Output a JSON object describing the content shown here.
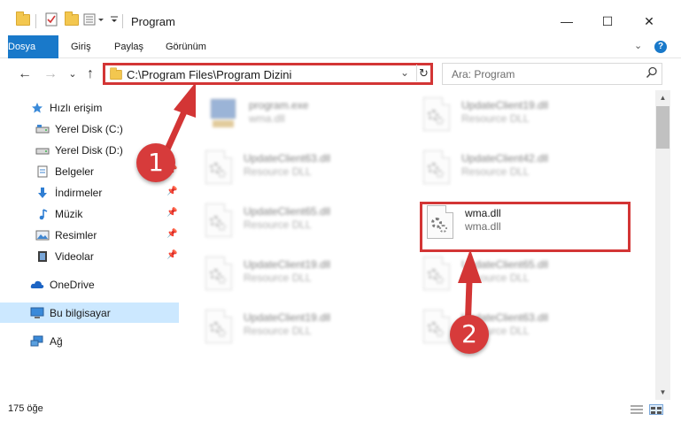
{
  "window": {
    "title": "Program",
    "minimize_glyph": "—",
    "maximize_glyph": "☐",
    "close_glyph": "✕"
  },
  "ribbon": {
    "tabs": [
      "Dosya",
      "Giriş",
      "Paylaş",
      "Görünüm"
    ],
    "help_label": "?",
    "collapse_glyph": "⌄"
  },
  "address": {
    "back_glyph": "←",
    "forward_glyph": "→",
    "recent_glyph": "⌄",
    "up_glyph": "↑",
    "path": "C:\\Program Files\\Program Dizini",
    "dropdown_glyph": "⌄",
    "refresh_glyph": "↻"
  },
  "search": {
    "placeholder": "Ara: Program"
  },
  "navigation": {
    "items": [
      {
        "label": "Hızlı erişim",
        "icon": "star-icon"
      },
      {
        "label": "Yerel Disk (C:)",
        "icon": "drive-icon",
        "pinned": true
      },
      {
        "label": "Yerel Disk (D:)",
        "icon": "drive-icon",
        "pinned": true
      },
      {
        "label": "Belgeler",
        "icon": "documents-icon",
        "pinned": true
      },
      {
        "label": "İndirmeler",
        "icon": "download-icon",
        "pinned": true
      },
      {
        "label": "Müzik",
        "icon": "music-icon",
        "pinned": true
      },
      {
        "label": "Resimler",
        "icon": "pictures-icon",
        "pinned": true
      },
      {
        "label": "Videolar",
        "icon": "videos-icon",
        "pinned": true
      },
      {
        "label": "OneDrive",
        "icon": "cloud-icon"
      },
      {
        "label": "Bu bilgisayar",
        "icon": "computer-icon",
        "selected": true
      },
      {
        "label": "Ağ",
        "icon": "network-icon"
      }
    ]
  },
  "files": [
    {
      "name": "program.exe",
      "type": "wma.dll",
      "icon": "exe-icon",
      "blurred": true
    },
    {
      "name": "UpdateClient19.dll",
      "type": "Resource DLL",
      "icon": "dll-icon",
      "blurred": true
    },
    {
      "name": "UpdateClient63.dll",
      "type": "Resource DLL",
      "icon": "dll-icon",
      "blurred": true
    },
    {
      "name": "UpdateClient42.dll",
      "type": "Resource DLL",
      "icon": "dll-icon",
      "blurred": true
    },
    {
      "name": "UpdateClient65.dll",
      "type": "Resource DLL",
      "icon": "dll-icon",
      "blurred": true
    },
    {
      "name": "wma.dll",
      "type": "wma.dll",
      "icon": "dll-icon",
      "blurred": false
    },
    {
      "name": "UpdateClient19.dll",
      "type": "Resource DLL",
      "icon": "dll-icon",
      "blurred": true
    },
    {
      "name": "UpdateClient65.dll",
      "type": "Resource DLL",
      "icon": "dll-icon",
      "blurred": true
    },
    {
      "name": "UpdateClient19.dll",
      "type": "Resource DLL",
      "icon": "dll-icon",
      "blurred": true
    },
    {
      "name": "UpdateClient63.dll",
      "type": "Resource DLL",
      "icon": "dll-icon",
      "blurred": true
    }
  ],
  "status": {
    "count": "175 öğe"
  },
  "annotations": {
    "badge_1": "1",
    "badge_2": "2",
    "color": "#d33535"
  }
}
